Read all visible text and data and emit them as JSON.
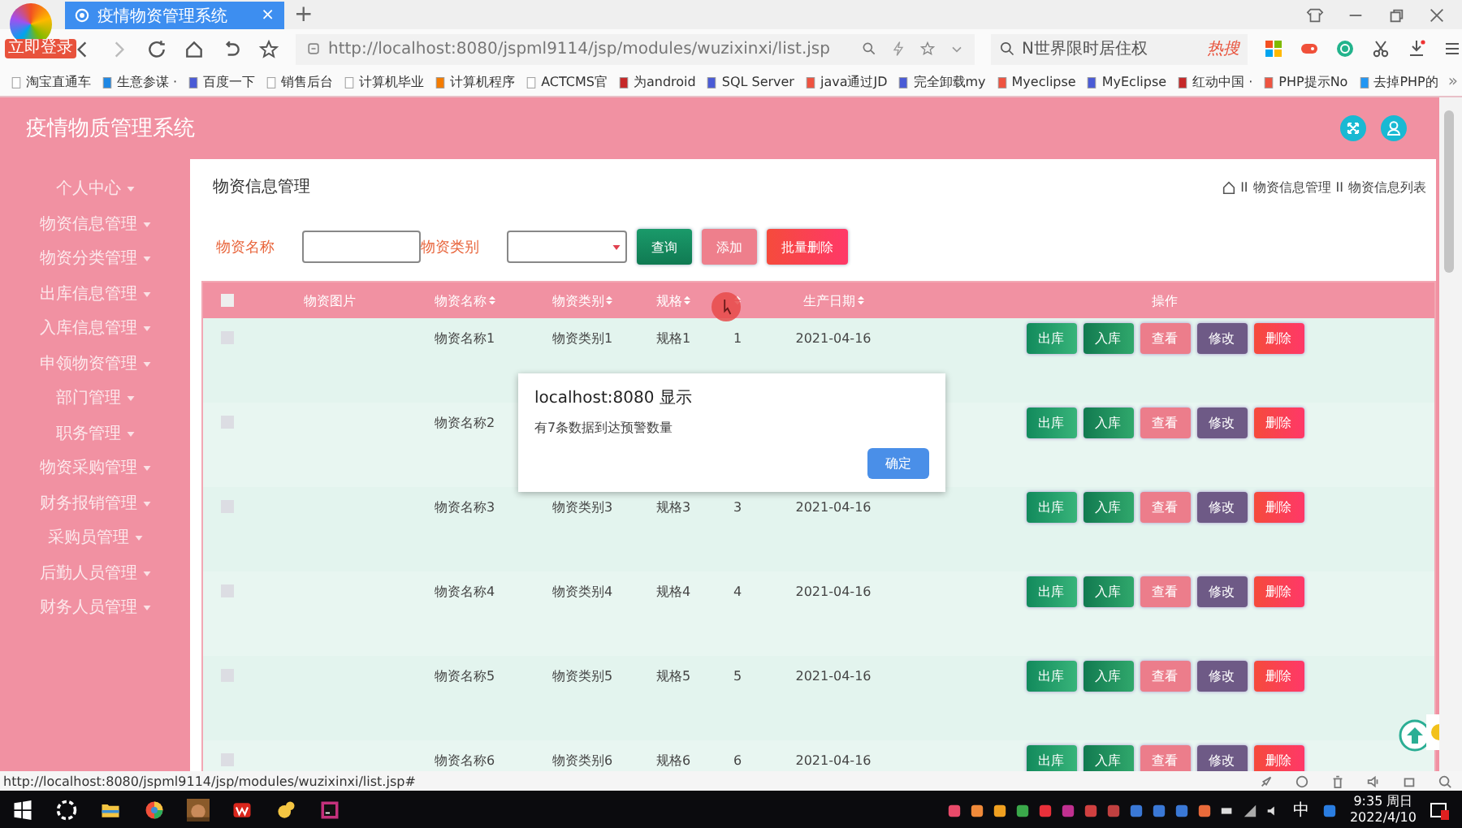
{
  "browser": {
    "tab": {
      "title": "疫情物资管理系统",
      "close": "×"
    },
    "new_tab": "+",
    "badge": "立即登录",
    "url": "http://localhost:8080/jspml9114/jsp/modules/wuzixinxi/list.jsp",
    "search": {
      "placeholder": "N世界限时居住权",
      "hot": "热搜"
    },
    "bookmarks": [
      "淘宝直通车",
      "生意参谋 ·",
      "百度一下",
      "销售后台",
      "计算机毕业",
      "计算机程序",
      "ACTCMS官",
      "为android",
      "SQL Server",
      "java通过JD",
      "完全卸载my",
      "Myeclipse",
      "MyEclipse",
      "红动中国 ·",
      "PHP提示No",
      "去掉PHP的"
    ],
    "more": "»"
  },
  "app": {
    "title": "疫情物质管理系统"
  },
  "sidebar": {
    "items": [
      "个人中心",
      "物资信息管理",
      "物资分类管理",
      "出库信息管理",
      "入库信息管理",
      "申领物资管理",
      "部门管理",
      "职务管理",
      "物资采购管理",
      "财务报销管理",
      "采购员管理",
      "后勤人员管理",
      "财务人员管理"
    ]
  },
  "page": {
    "title": "物资信息管理",
    "breadcrumb": {
      "items": [
        {
          "separator": "II",
          "label": "物资信息管理"
        },
        {
          "separator": "II",
          "label": "物资信息列表"
        }
      ]
    }
  },
  "search": {
    "fields": [
      {
        "label": "物资名称",
        "kind": "text"
      },
      {
        "label": "物资类别",
        "kind": "select"
      }
    ],
    "buttons": [
      {
        "label": "查询",
        "kind": "query"
      },
      {
        "label": "添加",
        "kind": "add"
      },
      {
        "label": "批量删除",
        "kind": "delete"
      }
    ]
  },
  "table": {
    "columns": [
      {
        "kind": "checkbox",
        "checked": false
      },
      {
        "kind": "text",
        "label": "物资图片",
        "sortable": false
      },
      {
        "kind": "text",
        "label": "物资名称",
        "sortable": true
      },
      {
        "kind": "text",
        "label": "物资类别",
        "sortable": true
      },
      {
        "kind": "text",
        "label": "规格",
        "sortable": true
      },
      {
        "kind": "text",
        "sortable": true
      },
      {
        "kind": "text",
        "label": "生产日期",
        "sortable": true
      },
      {
        "kind": "text",
        "label": "操作",
        "sortable": false
      }
    ],
    "rows": [
      {
        "checked": false,
        "name": "物资名称1",
        "category": "物资类别1",
        "spec": "规格1",
        "quantity": "1",
        "date": "2021-04-16",
        "actions": [
          "出库",
          "入库",
          "查看",
          "修改",
          "删除"
        ]
      },
      {
        "checked": false,
        "name": "物资名称2",
        "actions": [
          "出库",
          "入库",
          "查看",
          "修改",
          "删除"
        ]
      },
      {
        "checked": false,
        "name": "物资名称3",
        "category": "物资类别3",
        "spec": "规格3",
        "quantity": "3",
        "date": "2021-04-16",
        "actions": [
          "出库",
          "入库",
          "查看",
          "修改",
          "删除"
        ]
      },
      {
        "checked": false,
        "name": "物资名称4",
        "category": "物资类别4",
        "spec": "规格4",
        "quantity": "4",
        "date": "2021-04-16",
        "actions": [
          "出库",
          "入库",
          "查看",
          "修改",
          "删除"
        ]
      },
      {
        "checked": false,
        "name": "物资名称5",
        "category": "物资类别5",
        "spec": "规格5",
        "quantity": "5",
        "date": "2021-04-16",
        "actions": [
          "出库",
          "入库",
          "查看",
          "修改",
          "删除"
        ]
      },
      {
        "checked": false,
        "name": "物资名称6",
        "category": "物资类别6",
        "spec": "规格6",
        "quantity": "6",
        "date": "2021-04-16",
        "actions": [
          "出库",
          "入库",
          "查看",
          "修改",
          "删除"
        ]
      }
    ]
  },
  "dialog": {
    "title": "localhost:8080 显示",
    "message": "有7条数据到达预警数量",
    "button": "确定"
  },
  "status_bar": {
    "url": "http://localhost:8080/jspml9114/jsp/modules/wuzixinxi/list.jsp#"
  },
  "taskbar": {
    "ime": "中",
    "time": "9:35 周日",
    "date": "2022/4/10"
  }
}
